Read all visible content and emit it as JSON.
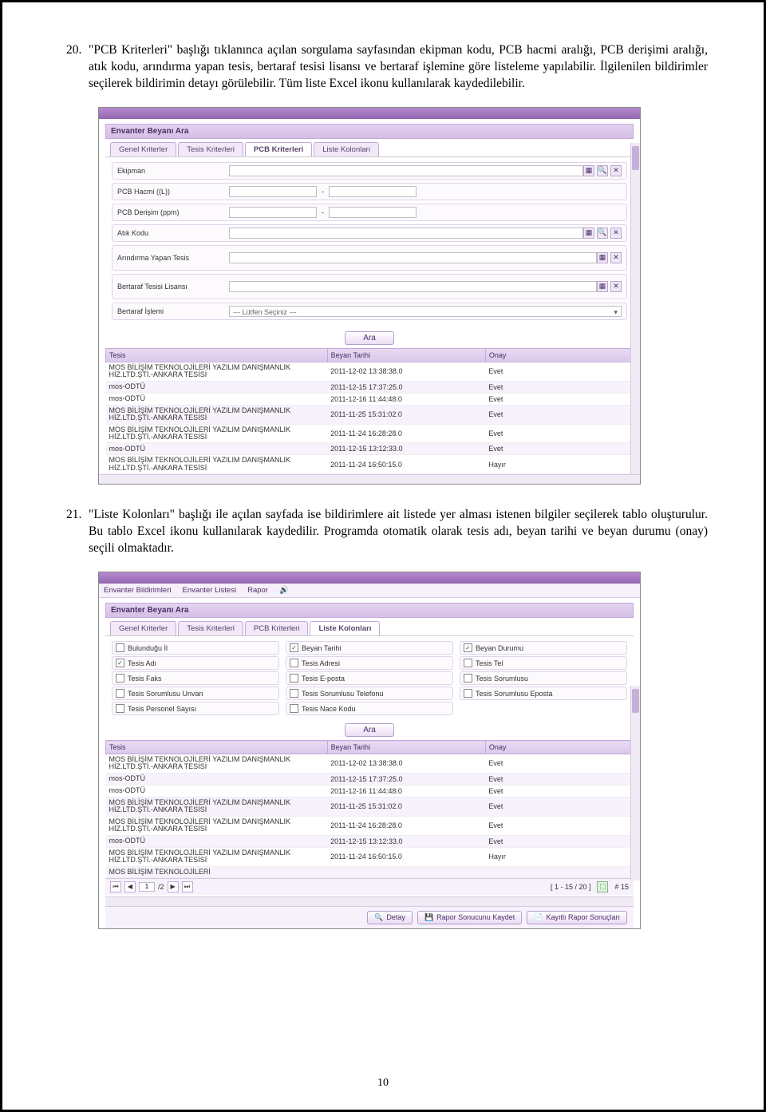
{
  "para20": {
    "num": "20.",
    "text": "\"PCB Kriterleri\" başlığı tıklanınca açılan sorgulama sayfasından ekipman kodu, PCB hacmi aralığı, PCB derişimi aralığı, atık kodu, arındırma yapan tesis, bertaraf tesisi lisansı ve bertaraf işlemine göre listeleme yapılabilir. İlgilenilen bildirimler seçilerek bildirimin detayı görülebilir. Tüm liste Excel ikonu kullanılarak kaydedilebilir."
  },
  "para21": {
    "num": "21.",
    "text": "\"Liste Kolonları\" başlığı ile açılan sayfada ise bildirimlere ait listede yer alması istenen bilgiler seçilerek tablo oluşturulur. Bu tablo Excel ikonu kullanılarak kaydedilir. Programda otomatik olarak tesis adı, beyan tarihi ve beyan durumu (onay) seçili olmaktadır."
  },
  "s1": {
    "panelTitle": "Envanter Beyanı Ara",
    "tabs": [
      "Genel Kriterler",
      "Tesis Kriterleri",
      "PCB Kriterleri",
      "Liste Kolonları"
    ],
    "activeTab": 2,
    "fields": {
      "ekipman": "Ekipman",
      "pcbHacmi": "PCB Hacmi ((L))",
      "pcbDerisim": "PCB Derişim (ppm)",
      "atikKodu": "Atık Kodu",
      "arindirma": "Arındırma Yapan Tesis",
      "bertarafLisans": "Bertaraf Tesisi Lisansı",
      "bertarafIslemi": "Bertaraf İşlemi",
      "bertarafSelect": "--- Lütfen Seçiniz ---"
    },
    "btnAra": "Ara",
    "gridHeaders": [
      "Tesis",
      "Beyan Tarihi",
      "Onay"
    ],
    "rows": [
      {
        "tesis": "MOS BİLİŞİM TEKNOLOJİLERİ YAZILIM DANIŞMANLIK HİZ.LTD.ŞTİ.-ANKARA TESİSİ",
        "tarih": "2011-12-02 13:38:38.0",
        "onay": "Evet"
      },
      {
        "tesis": "mos-ODTÜ",
        "tarih": "2011-12-15 17:37:25.0",
        "onay": "Evet"
      },
      {
        "tesis": "mos-ODTÜ",
        "tarih": "2011-12-16 11:44:48.0",
        "onay": "Evet"
      },
      {
        "tesis": "MOS BİLİŞİM TEKNOLOJİLERİ YAZILIM DANIŞMANLIK HİZ.LTD.ŞTİ.-ANKARA TESİSİ",
        "tarih": "2011-11-25 15:31:02.0",
        "onay": "Evet"
      },
      {
        "tesis": "MOS BİLİŞİM TEKNOLOJİLERİ YAZILIM DANIŞMANLIK HİZ.LTD.ŞTİ.-ANKARA TESİSİ",
        "tarih": "2011-11-24 16:28:28.0",
        "onay": "Evet"
      },
      {
        "tesis": "mos-ODTÜ",
        "tarih": "2011-12-15 13:12:33.0",
        "onay": "Evet"
      },
      {
        "tesis": "MOS BİLİŞİM TEKNOLOJİLERİ YAZILIM DANIŞMANLIK HİZ.LTD.ŞTİ.-ANKARA TESİSİ",
        "tarih": "2011-11-24 16:50:15.0",
        "onay": "Hayır"
      }
    ]
  },
  "s2": {
    "menu": [
      "Envanter Bildirimleri",
      "Envanter Listesi",
      "Rapor"
    ],
    "panelTitle": "Envanter Beyanı Ara",
    "tabs": [
      "Genel Kriterler",
      "Tesis Kriterleri",
      "PCB Kriterleri",
      "Liste Kolonları"
    ],
    "activeTab": 3,
    "checks": [
      {
        "label": "Bulunduğu İl",
        "checked": false
      },
      {
        "label": "Beyan Tarihi",
        "checked": true
      },
      {
        "label": "Beyan Durumu",
        "checked": true
      },
      {
        "label": "Tesis Adı",
        "checked": true
      },
      {
        "label": "Tesis Adresi",
        "checked": false
      },
      {
        "label": "Tesis Tel",
        "checked": false
      },
      {
        "label": "Tesis Faks",
        "checked": false
      },
      {
        "label": "Tesis E-posta",
        "checked": false
      },
      {
        "label": "Tesis Sorumlusu",
        "checked": false
      },
      {
        "label": "Tesis Sorumlusu Unvan",
        "checked": false
      },
      {
        "label": "Tesis Sorumlusu Telefonu",
        "checked": false
      },
      {
        "label": "Tesis Sorumlusu Eposta",
        "checked": false
      },
      {
        "label": "Tesis Personel Sayısı",
        "checked": false
      },
      {
        "label": "Tesis Nace Kodu",
        "checked": false
      }
    ],
    "btnAra": "Ara",
    "gridHeaders": [
      "Tesis",
      "Beyan Tarihi",
      "Onay"
    ],
    "rows": [
      {
        "tesis": "MOS BİLİŞİM TEKNOLOJİLERİ YAZILIM DANIŞMANLIK HİZ.LTD.ŞTİ.-ANKARA TESİSİ",
        "tarih": "2011-12-02 13:38:38.0",
        "onay": "Evet"
      },
      {
        "tesis": "mos-ODTÜ",
        "tarih": "2011-12-15 17:37:25.0",
        "onay": "Evet"
      },
      {
        "tesis": "mos-ODTÜ",
        "tarih": "2011-12-16 11:44:48.0",
        "onay": "Evet"
      },
      {
        "tesis": "MOS BİLİŞİM TEKNOLOJİLERİ YAZILIM DANIŞMANLIK HİZ.LTD.ŞTİ.-ANKARA TESİSİ",
        "tarih": "2011-11-25 15:31:02.0",
        "onay": "Evet"
      },
      {
        "tesis": "MOS BİLİŞİM TEKNOLOJİLERİ YAZILIM DANIŞMANLIK HİZ.LTD.ŞTİ.-ANKARA TESİSİ",
        "tarih": "2011-11-24 16:28:28.0",
        "onay": "Evet"
      },
      {
        "tesis": "mos-ODTÜ",
        "tarih": "2011-12-15 13:12:33.0",
        "onay": "Evet"
      },
      {
        "tesis": "MOS BİLİŞİM TEKNOLOJİLERİ YAZILIM DANIŞMANLIK HİZ.LTD.ŞTİ.-ANKARA TESİSİ",
        "tarih": "2011-11-24 16:50:15.0",
        "onay": "Hayır"
      },
      {
        "tesis": "MOS BİLİŞİM TEKNOLOJİLERİ",
        "tarih": "",
        "onay": ""
      }
    ],
    "pager": {
      "page": "1",
      "of": "/2",
      "range": "[ 1 - 15 / 20 ]",
      "perPage": "# 15"
    },
    "footerBtns": {
      "detay": "Detay",
      "kaydet": "Rapor Sonucunu Kaydet",
      "kayitli": "Kayıtlı Rapor Sonuçları"
    }
  },
  "pageNum": "10"
}
